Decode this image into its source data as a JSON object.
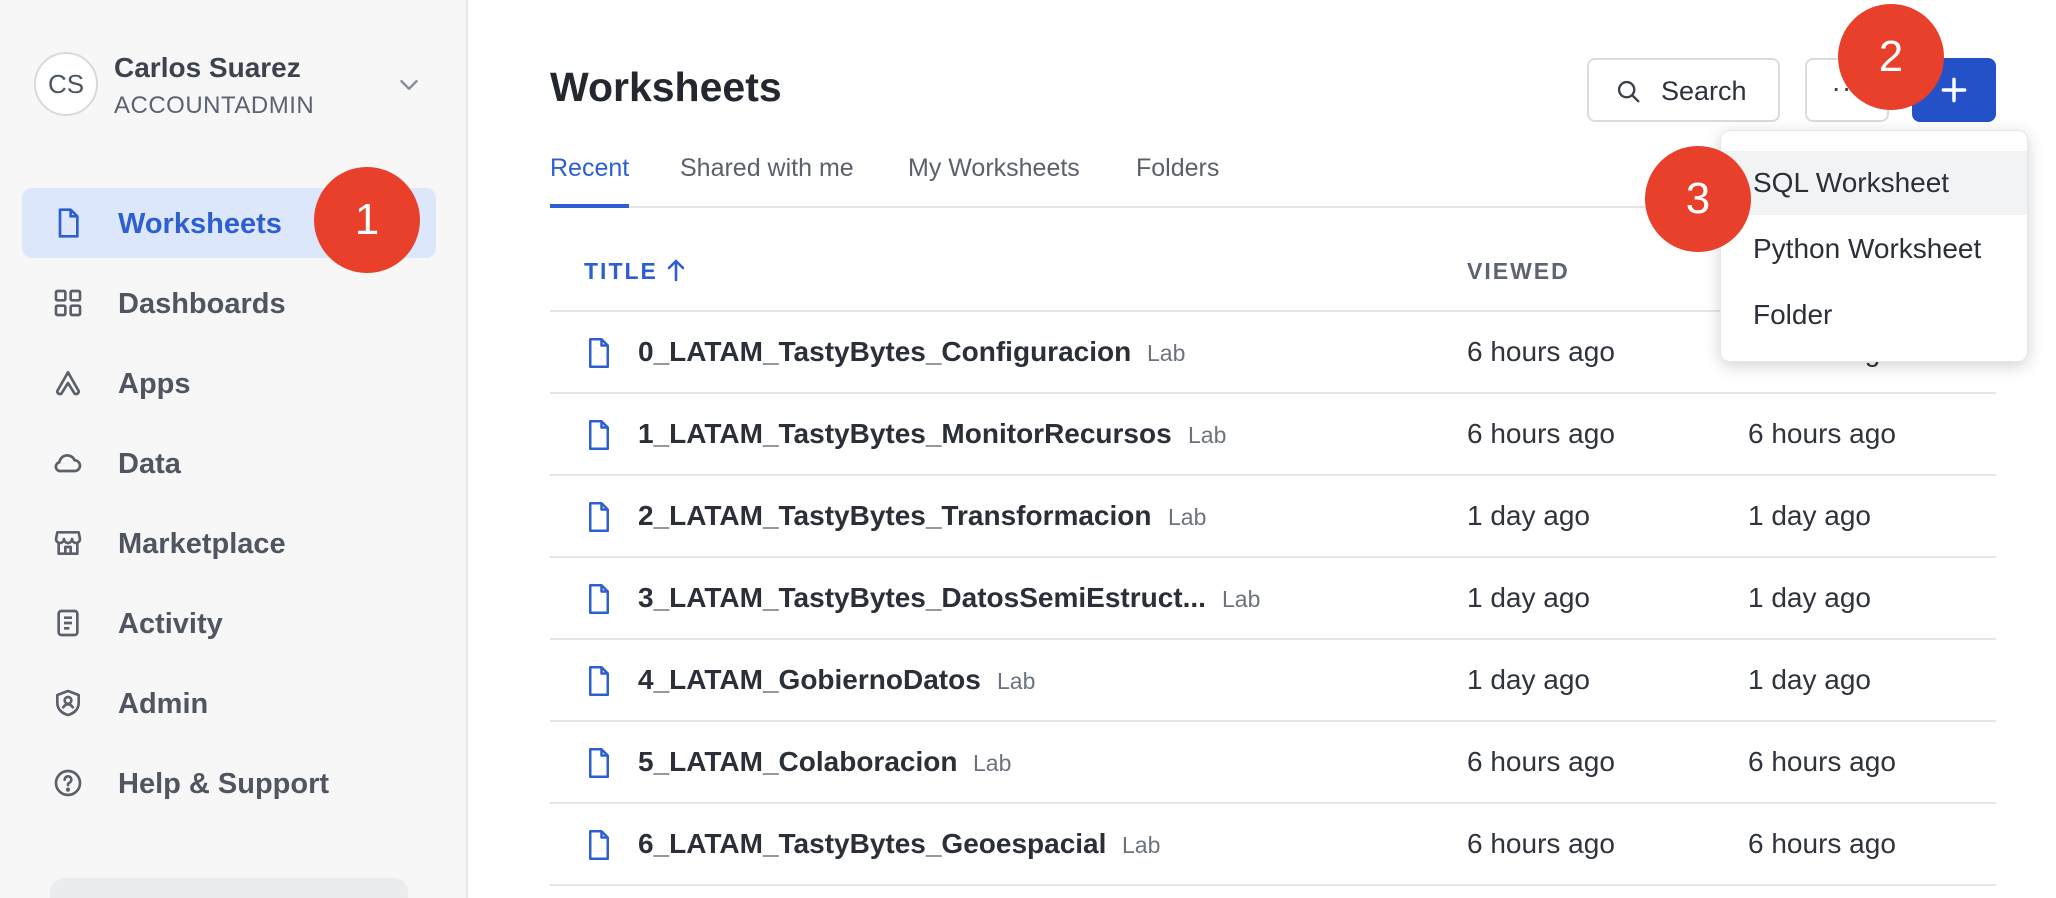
{
  "user": {
    "initials": "CS",
    "name": "Carlos Suarez",
    "role": "ACCOUNTADMIN"
  },
  "sidebar": {
    "items": [
      {
        "label": "Worksheets",
        "icon": "file-icon",
        "active": true
      },
      {
        "label": "Dashboards",
        "icon": "grid-icon",
        "active": false
      },
      {
        "label": "Apps",
        "icon": "apps-icon",
        "active": false
      },
      {
        "label": "Data",
        "icon": "cloud-icon",
        "active": false
      },
      {
        "label": "Marketplace",
        "icon": "store-icon",
        "active": false
      },
      {
        "label": "Activity",
        "icon": "activity-icon",
        "active": false
      },
      {
        "label": "Admin",
        "icon": "shield-icon",
        "active": false
      },
      {
        "label": "Help & Support",
        "icon": "help-icon",
        "active": false
      }
    ]
  },
  "header": {
    "title": "Worksheets",
    "search_label": "Search",
    "more_label": "···"
  },
  "tabs": [
    {
      "label": "Recent",
      "active": true
    },
    {
      "label": "Shared with me",
      "active": false
    },
    {
      "label": "My Worksheets",
      "active": false
    },
    {
      "label": "Folders",
      "active": false
    }
  ],
  "table": {
    "columns": {
      "title": "TITLE",
      "viewed": "VIEWED"
    },
    "rows": [
      {
        "title": "0_LATAM_TastyBytes_Configuracion",
        "badge": "Lab",
        "viewed": "6 hours ago",
        "updated": "6 hours ago"
      },
      {
        "title": "1_LATAM_TastyBytes_MonitorRecursos",
        "badge": "Lab",
        "viewed": "6 hours ago",
        "updated": "6 hours ago"
      },
      {
        "title": "2_LATAM_TastyBytes_Transformacion",
        "badge": "Lab",
        "viewed": "1 day ago",
        "updated": "1 day ago"
      },
      {
        "title": "3_LATAM_TastyBytes_DatosSemiEstruct...",
        "badge": "Lab",
        "viewed": "1 day ago",
        "updated": "1 day ago"
      },
      {
        "title": "4_LATAM_GobiernoDatos",
        "badge": "Lab",
        "viewed": "1 day ago",
        "updated": "1 day ago"
      },
      {
        "title": "5_LATAM_Colaboracion",
        "badge": "Lab",
        "viewed": "6 hours ago",
        "updated": "6 hours ago"
      },
      {
        "title": "6_LATAM_TastyBytes_Geoespacial",
        "badge": "Lab",
        "viewed": "6 hours ago",
        "updated": "6 hours ago"
      }
    ]
  },
  "dropdown": {
    "items": [
      "SQL Worksheet",
      "Python Worksheet",
      "Folder"
    ]
  },
  "markers": [
    "1",
    "2",
    "3"
  ],
  "colors": {
    "accent": "#2e5fd1",
    "primary_button": "#2451c8",
    "marker": "#e8402a",
    "active_nav_bg": "#dde7fb"
  }
}
